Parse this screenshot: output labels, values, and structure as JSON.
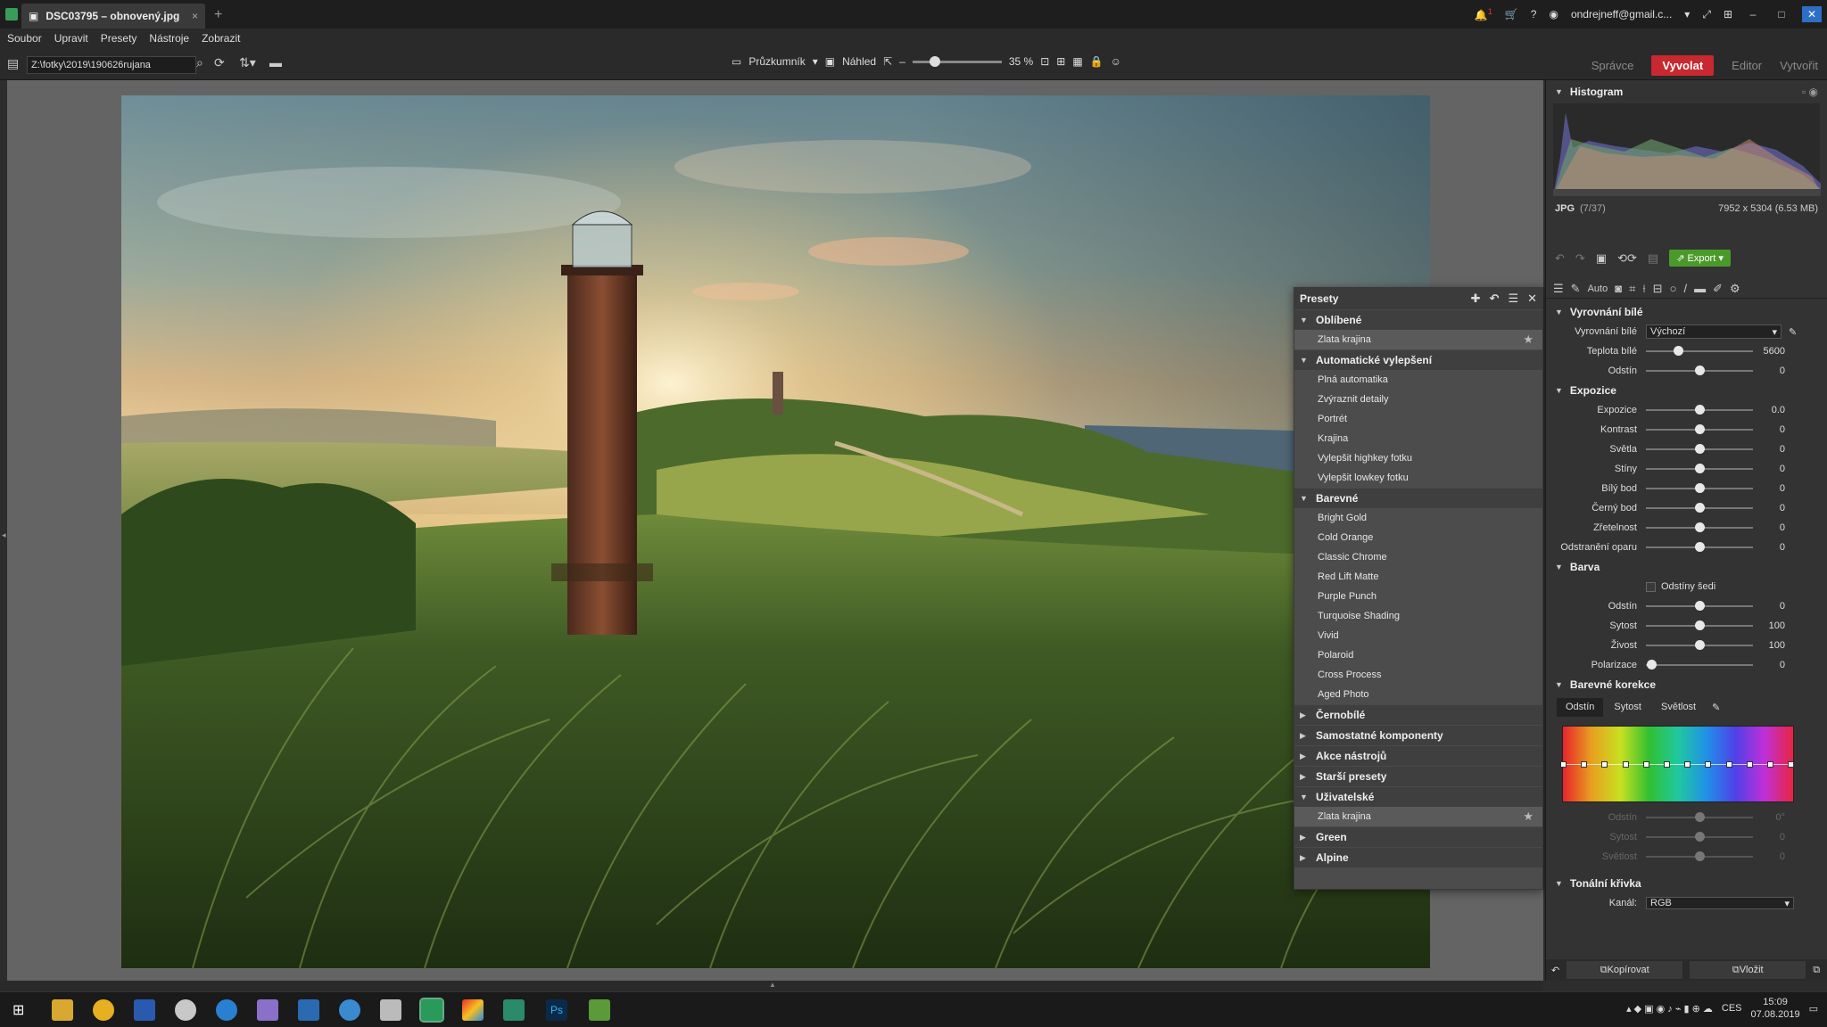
{
  "window": {
    "tab_title": "DSC03795 – obnovený.jpg",
    "tab_close": "×",
    "tab_new": "+",
    "account": "ondrejneff@gmail.c...",
    "help": "?",
    "notif_count": "1"
  },
  "menu": [
    "Soubor",
    "Upravit",
    "Presety",
    "Nástroje",
    "Zobrazit"
  ],
  "toolbar": {
    "path": "Z:\\fotky\\2019\\190626rujana",
    "explorer": "Průzkumník",
    "preview": "Náhled",
    "zoom": "35 %",
    "zoom_level": 0.25
  },
  "modes": {
    "manager": "Správce",
    "develop": "Vyvolat",
    "editor": "Editor",
    "create": "Vytvořit"
  },
  "presets": {
    "title": "Presety",
    "groups": [
      {
        "name": "Oblíbené",
        "open": true,
        "items": [
          {
            "label": "Zlata krajina",
            "star": true
          }
        ]
      },
      {
        "name": "Automatické vylepšení",
        "open": true,
        "items": [
          {
            "label": "Plná automatika"
          },
          {
            "label": "Zvýraznit detaily"
          },
          {
            "label": "Portrét"
          },
          {
            "label": "Krajina"
          },
          {
            "label": "Vylepšit highkey fotku"
          },
          {
            "label": "Vylepšit lowkey fotku"
          }
        ]
      },
      {
        "name": "Barevné",
        "open": true,
        "items": [
          {
            "label": "Bright Gold"
          },
          {
            "label": "Cold Orange"
          },
          {
            "label": "Classic Chrome"
          },
          {
            "label": "Red Lift Matte"
          },
          {
            "label": "Purple Punch"
          },
          {
            "label": "Turquoise Shading"
          },
          {
            "label": "Vivid"
          },
          {
            "label": "Polaroid"
          },
          {
            "label": "Cross Process"
          },
          {
            "label": "Aged Photo"
          }
        ]
      },
      {
        "name": "Černobílé",
        "open": false,
        "items": []
      },
      {
        "name": "Samostatné komponenty",
        "open": false,
        "items": []
      },
      {
        "name": "Akce nástrojů",
        "open": false,
        "items": []
      },
      {
        "name": "Starší presety",
        "open": false,
        "items": []
      },
      {
        "name": "Uživatelské",
        "open": true,
        "items": [
          {
            "label": "Zlata krajina",
            "star": true
          }
        ]
      },
      {
        "name": "Green",
        "open": false,
        "items": []
      },
      {
        "name": "Alpine",
        "open": false,
        "items": []
      }
    ]
  },
  "histogram": {
    "title": "Histogram",
    "format": "JPG",
    "index": "(7/37)",
    "dimensions": "7952 x 5304 (6.53 MB)"
  },
  "export_label": "Export",
  "auto_label": "Auto",
  "white_balance": {
    "title": "Vyrovnání bílé",
    "label": "Vyrovnání bílé",
    "value": "Výchozí",
    "rows": [
      {
        "label": "Teplota bílé",
        "value": "5600",
        "pos": 0.3
      },
      {
        "label": "Odstín",
        "value": "0",
        "pos": 0.5
      }
    ]
  },
  "exposure": {
    "title": "Expozice",
    "rows": [
      {
        "label": "Expozice",
        "value": "0.0",
        "pos": 0.5
      },
      {
        "label": "Kontrast",
        "value": "0",
        "pos": 0.5
      },
      {
        "label": "Světla",
        "value": "0",
        "pos": 0.5
      },
      {
        "label": "Stíny",
        "value": "0",
        "pos": 0.5
      },
      {
        "label": "Bílý bod",
        "value": "0",
        "pos": 0.5
      },
      {
        "label": "Černý bod",
        "value": "0",
        "pos": 0.5
      },
      {
        "label": "Zřetelnost",
        "value": "0",
        "pos": 0.5
      },
      {
        "label": "Odstranění oparu",
        "value": "0",
        "pos": 0.5
      }
    ]
  },
  "color": {
    "title": "Barva",
    "grayscale": "Odstíny šedi",
    "rows": [
      {
        "label": "Odstín",
        "value": "0",
        "pos": 0.5
      },
      {
        "label": "Sytost",
        "value": "100",
        "pos": 0.5
      },
      {
        "label": "Živost",
        "value": "100",
        "pos": 0.5
      },
      {
        "label": "Polarizace",
        "value": "0",
        "pos": 0.05
      }
    ]
  },
  "color_correction": {
    "title": "Barevné korekce",
    "tabs": [
      "Odstín",
      "Sytost",
      "Světlost"
    ],
    "rows": [
      {
        "label": "Odstín",
        "value": "0°",
        "pos": 0.5
      },
      {
        "label": "Sytost",
        "value": "0",
        "pos": 0.5
      },
      {
        "label": "Světlost",
        "value": "0",
        "pos": 0.5
      }
    ]
  },
  "tone_curve": {
    "title": "Tonální křivka",
    "channel_label": "Kanál:",
    "channel": "RGB"
  },
  "bottom": {
    "copy": "Kopírovat",
    "paste": "Vložit"
  },
  "taskbar": {
    "lang": "CES",
    "time": "15:09",
    "date": "07.08.2019"
  },
  "colors": {
    "accent": "#c8282f",
    "export": "#4a9a2a"
  }
}
